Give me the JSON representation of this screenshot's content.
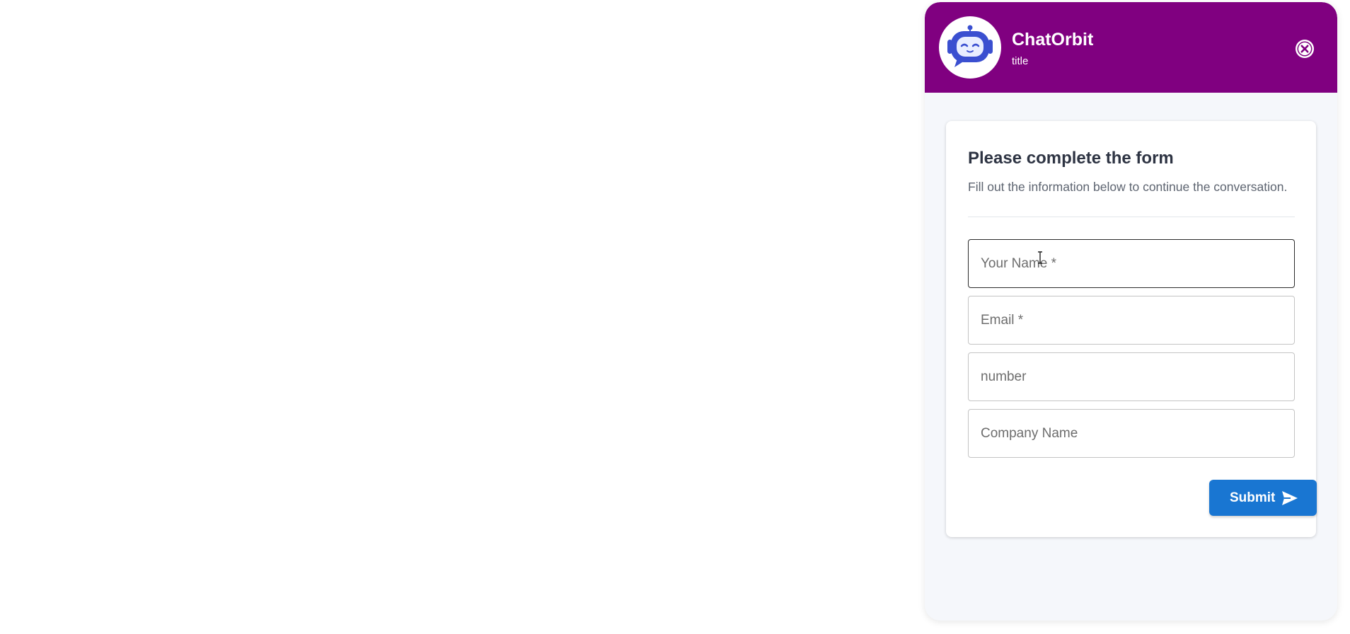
{
  "header": {
    "brand_name": "ChatOrbit",
    "subtitle": "title",
    "avatar_icon": "robot-icon",
    "close_icon": "close-icon",
    "background_color": "#800080"
  },
  "form": {
    "title": "Please complete the form",
    "description": "Fill out the information below to continue the conversation.",
    "fields": [
      {
        "placeholder": "Your Name *",
        "value": ""
      },
      {
        "placeholder": "Email *",
        "value": ""
      },
      {
        "placeholder": "number",
        "value": ""
      },
      {
        "placeholder": "Company Name",
        "value": ""
      }
    ],
    "submit_label": "Submit",
    "submit_icon": "send-icon",
    "accent_color": "#1976d2"
  }
}
